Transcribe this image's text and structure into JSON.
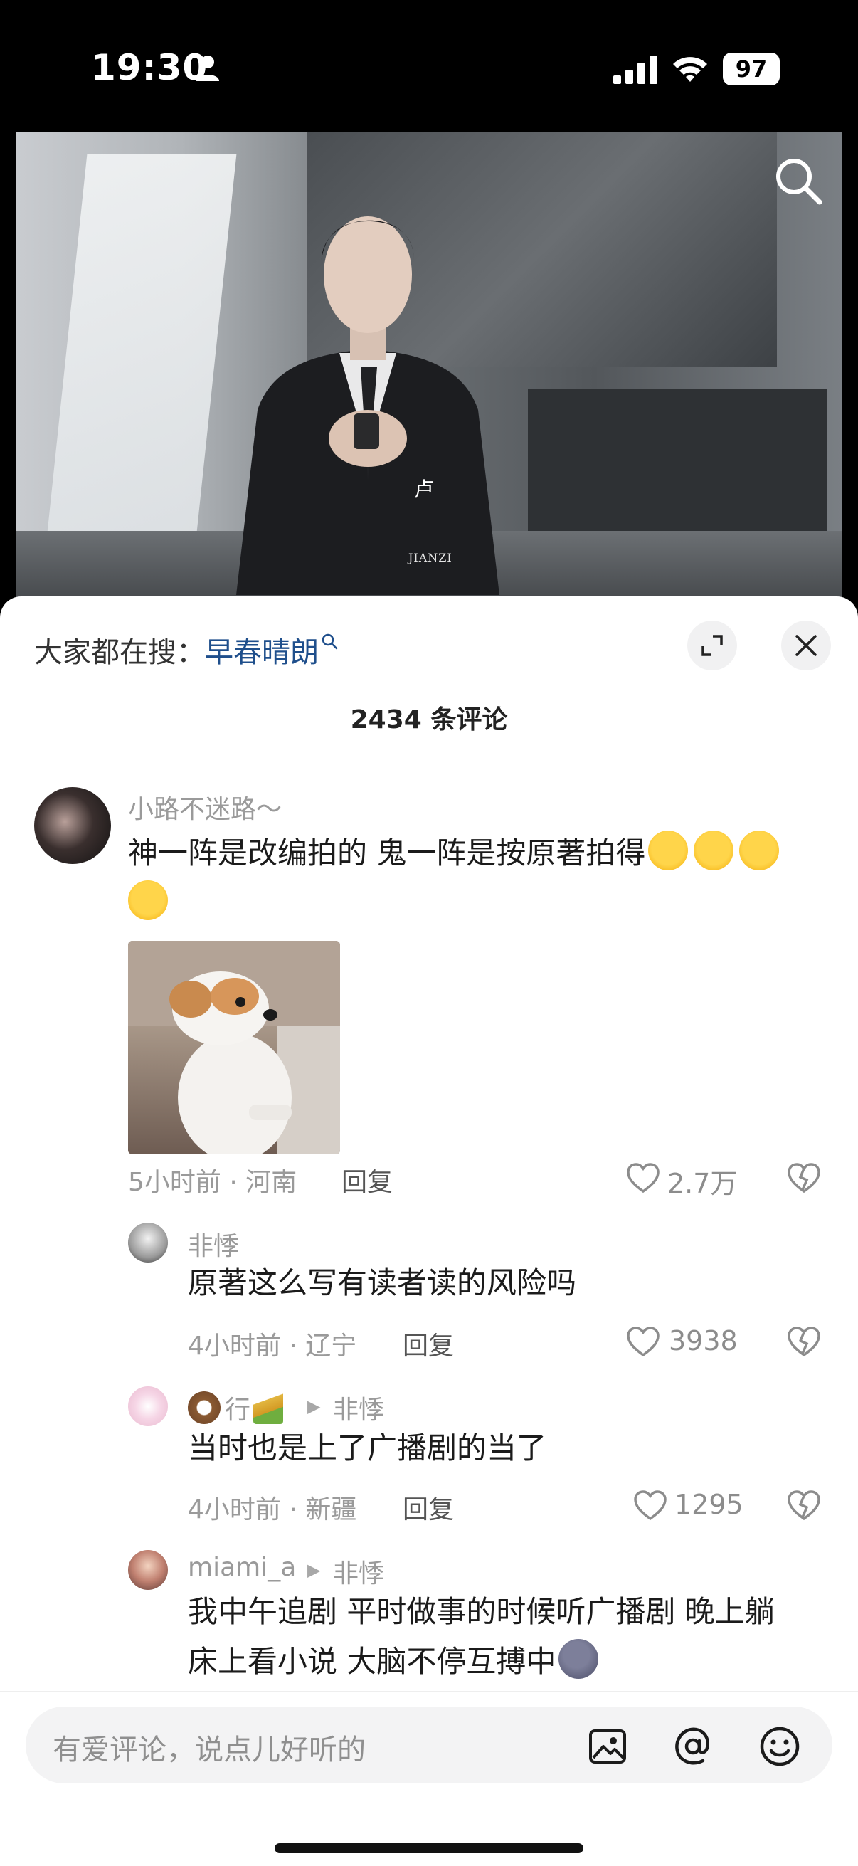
{
  "status_bar": {
    "time": "19:30",
    "battery": "97"
  },
  "video": {
    "subtitle": "卢",
    "watermark": "JIANZI"
  },
  "trending": {
    "prefix": "大家都在搜：",
    "keyword": "早春晴朗"
  },
  "comment_count": "2434 条评论",
  "comments": [
    {
      "user": "小路不迷路～",
      "text_lines": [
        "神一阵是改编拍的 鬼一阵是按原著拍得",
        ""
      ],
      "time_location": "5小时前 · 河南",
      "reply_label": "回复",
      "likes": "2.7万"
    }
  ],
  "replies": [
    {
      "user": "非悸",
      "text": "原著这么写有读者读的风险吗",
      "time_location": "4小时前 · 辽宁",
      "reply_label": "回复",
      "likes": "3938"
    },
    {
      "user": "行",
      "reply_to": "非悸",
      "text": "当时也是上了广播剧的当了",
      "time_location": "4小时前 · 新疆",
      "reply_label": "回复",
      "likes": "1295"
    },
    {
      "user": "miami_a",
      "reply_to": "非悸",
      "text_lines": [
        "我中午追剧 平时做事的时候听广播剧 晚上躺",
        "床上看小说 大脑不停互搏中"
      ]
    }
  ],
  "input": {
    "placeholder": "有爱评论，说点儿好听的"
  },
  "icons": [
    "person-icon",
    "signal-icon",
    "wifi-icon",
    "search-icon",
    "expand-icon",
    "close-icon",
    "heart-icon",
    "dislike-icon",
    "image-icon",
    "at-icon",
    "emoji-icon"
  ]
}
